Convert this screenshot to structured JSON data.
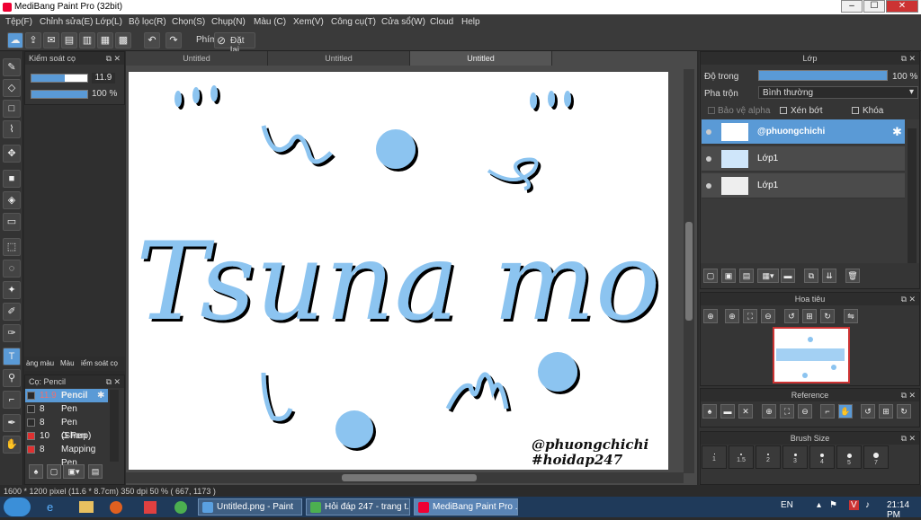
{
  "window": {
    "title": "MediBang Paint Pro (32bit)",
    "min": "–",
    "max": "☐",
    "close": "✕"
  },
  "menu": [
    "Tệp(F)",
    "Chỉnh sửa(E)",
    "Lớp(L)",
    "Bộ lọc(R)",
    "Chọn(S)",
    "Chụp(N)",
    "Màu (C)",
    "Xem(V)",
    "Công cụ(T)",
    "Cửa sổ(W)",
    "Cloud",
    "Help"
  ],
  "toolbar": {
    "filter_label": "Phím",
    "reset_label": "Đặt lại"
  },
  "brush_control": {
    "title": "Kiểm soát cọ",
    "size": "11.9",
    "opacity": "100 %",
    "size_fill": 0.6,
    "opacity_fill": 1.0
  },
  "tabs_left": [
    "àng màu",
    "Màu",
    "iểm soát cọ"
  ],
  "brush_panel": {
    "title": "Cọ: Pencil",
    "items": [
      {
        "size": "11.9",
        "name": "Pencil",
        "color": "#2a2a2a",
        "selected": true
      },
      {
        "size": "8",
        "name": "Pen",
        "color": "#2a2a2a",
        "selected": false
      },
      {
        "size": "8",
        "name": "Pen (Sharp)",
        "color": "#2a2a2a",
        "selected": false
      },
      {
        "size": "10",
        "name": "G Pen",
        "color": "#e03030",
        "selected": false
      },
      {
        "size": "8",
        "name": "Mapping Pen",
        "color": "#e03030",
        "selected": false
      }
    ]
  },
  "canvas_tabs": [
    "Untitled",
    "Untitled",
    "Untitled"
  ],
  "canvas_text": {
    "main": "Tsuna mo",
    "handle": "@phuongchichi",
    "tag": "#hoidap247"
  },
  "layer_panel": {
    "title": "Lớp",
    "opacity_label": "Độ trong",
    "opacity_value": "100 %",
    "opacity_fill": 1.0,
    "blend_label": "Pha trộn",
    "blend_value": "Bình thường",
    "protect_alpha": "Bảo vệ alpha",
    "clip": "Xén bớt",
    "lock": "Khóa",
    "layers": [
      {
        "name": "@phuongchichi",
        "selected": true
      },
      {
        "name": "Lớp1",
        "selected": false
      },
      {
        "name": "Lớp1",
        "selected": false
      }
    ]
  },
  "navigator": {
    "title": "Hoa tiêu"
  },
  "reference": {
    "title": "Reference"
  },
  "brush_size": {
    "title": "Brush Size",
    "sizes": [
      "1",
      "1.5",
      "2",
      "3",
      "4",
      "5",
      "7"
    ]
  },
  "status": {
    "text": "1600 * 1200 pixel  (11.6 * 8.7cm)  350 dpi  50 %  ( 667, 1173 )"
  },
  "taskbar": {
    "tasks": [
      "Untitled.png - Paint",
      "Hỏi đáp 247 - trang t...",
      "MediBang Paint Pro ..."
    ],
    "lang": "EN",
    "time": "21:14 PM"
  },
  "colors": {
    "accent": "#5a9ad6",
    "ink": "#8cc4f0"
  }
}
